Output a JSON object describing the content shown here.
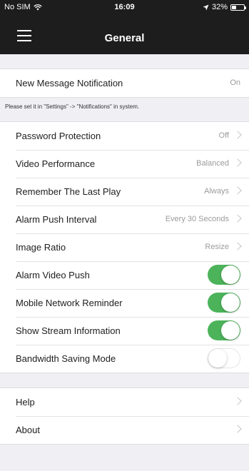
{
  "status": {
    "carrier": "No SIM",
    "time": "16:09",
    "battery": "32%"
  },
  "nav": {
    "title": "General"
  },
  "notification": {
    "label": "New Message Notification",
    "value": "On",
    "note": "Please set it in \"Settings\" -> \"Notifications\" in system."
  },
  "settings": [
    {
      "label": "Password Protection",
      "value": "Off"
    },
    {
      "label": "Video Performance",
      "value": "Balanced"
    },
    {
      "label": "Remember The Last Play",
      "value": "Always"
    },
    {
      "label": "Alarm Push Interval",
      "value": "Every 30 Seconds"
    },
    {
      "label": "Image Ratio",
      "value": "Resize"
    }
  ],
  "toggles": [
    {
      "label": "Alarm Video Push",
      "on": true
    },
    {
      "label": "Mobile Network Reminder",
      "on": true
    },
    {
      "label": "Show Stream Information",
      "on": true
    },
    {
      "label": "Bandwidth Saving Mode",
      "on": false
    }
  ],
  "more": [
    {
      "label": "Help"
    },
    {
      "label": "About"
    }
  ],
  "colors": {
    "toggle_on": "#4cb35a",
    "bar_background": "#1d1d1d"
  }
}
